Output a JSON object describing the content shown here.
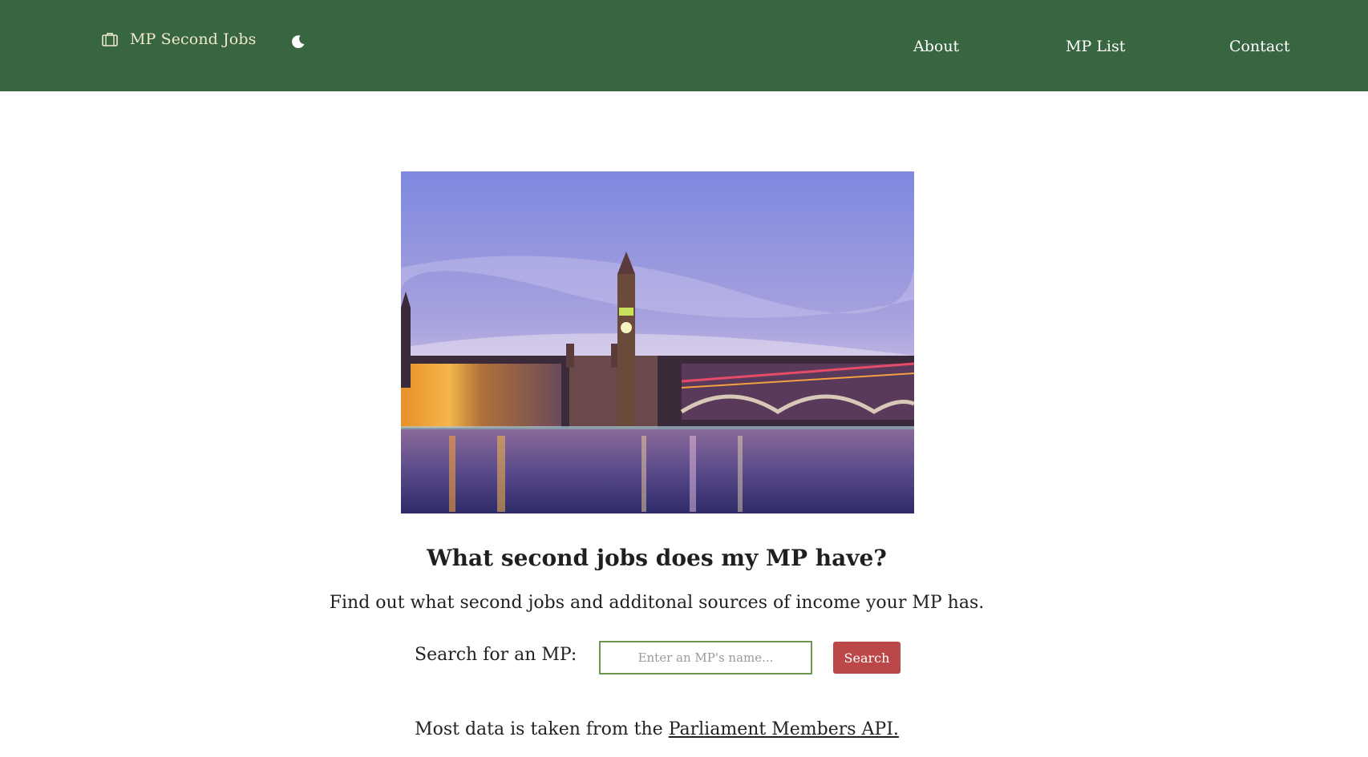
{
  "header": {
    "brand_icon": "briefcase-icon",
    "brand_label": "MP Second Jobs",
    "theme_toggle_icon": "moon-icon",
    "nav": [
      {
        "label": "About"
      },
      {
        "label": "MP List"
      },
      {
        "label": "Contact"
      }
    ],
    "colors": {
      "background": "#386641",
      "brand_text": "#f2e8cf",
      "nav_text": "#ffffff"
    }
  },
  "main": {
    "hero_image": "houses-of-parliament-photo",
    "headline": "What second jobs does my MP have?",
    "subheadline": "Find out what second jobs and additonal sources of income your MP has.",
    "search": {
      "label": "Search for an MP:",
      "placeholder": "Enter an MP's name...",
      "value": "",
      "button_label": "Search",
      "colors": {
        "input_border": "#6a994e",
        "button": "#bc4749"
      }
    },
    "footer_note": {
      "prefix": "Most data is taken from the ",
      "link_text": "Parliament Members API."
    }
  }
}
